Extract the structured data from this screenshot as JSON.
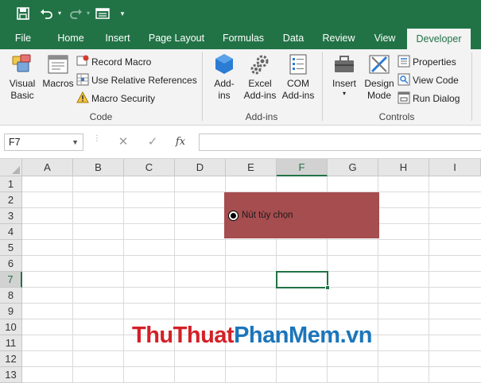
{
  "quick_access": {
    "save_icon": "save-icon",
    "undo_icon": "undo-icon",
    "redo_icon": "redo-icon",
    "form_icon": "form-icon",
    "customize_icon": "chevron-down-icon"
  },
  "tabs": [
    {
      "label": "File"
    },
    {
      "label": "Home"
    },
    {
      "label": "Insert"
    },
    {
      "label": "Page Layout"
    },
    {
      "label": "Formulas"
    },
    {
      "label": "Data"
    },
    {
      "label": "Review"
    },
    {
      "label": "View"
    },
    {
      "label": "Developer"
    }
  ],
  "ribbon": {
    "code": {
      "label": "Code",
      "visual_basic": "Visual\nBasic",
      "visual_basic_l1": "Visual",
      "visual_basic_l2": "Basic",
      "macros": "Macros",
      "record_macro": "Record Macro",
      "use_relative": "Use Relative References",
      "macro_security": "Macro Security"
    },
    "addins": {
      "label": "Add-ins",
      "addins_l1": "Add-",
      "addins_l2": "ins",
      "excel_l1": "Excel",
      "excel_l2": "Add-ins",
      "com_l1": "COM",
      "com_l2": "Add-ins"
    },
    "controls": {
      "label": "Controls",
      "insert": "Insert",
      "design_l1": "Design",
      "design_l2": "Mode",
      "properties": "Properties",
      "view_code": "View Code",
      "run_dialog": "Run Dialog"
    }
  },
  "formula_bar": {
    "name_box": "F7",
    "cancel": "✕",
    "enter": "✓",
    "fx": "fx",
    "value": ""
  },
  "grid": {
    "columns": [
      "A",
      "B",
      "C",
      "D",
      "E",
      "F",
      "G",
      "H",
      "I"
    ],
    "rows": [
      "1",
      "2",
      "3",
      "4",
      "5",
      "6",
      "7",
      "8",
      "9",
      "10",
      "11",
      "12",
      "13"
    ],
    "selected_column": "F",
    "selected_row": "7"
  },
  "option_button": {
    "label": "Nút tùy chọn",
    "fill_color": "#a64d4f"
  },
  "watermark": {
    "part1": "Thu",
    "part2": "Thuat",
    "part3": "Phan",
    "part4": "Mem",
    "part5": ".vn"
  },
  "colors": {
    "accent": "#217346",
    "ribbon_bg": "#f3f3f3"
  }
}
